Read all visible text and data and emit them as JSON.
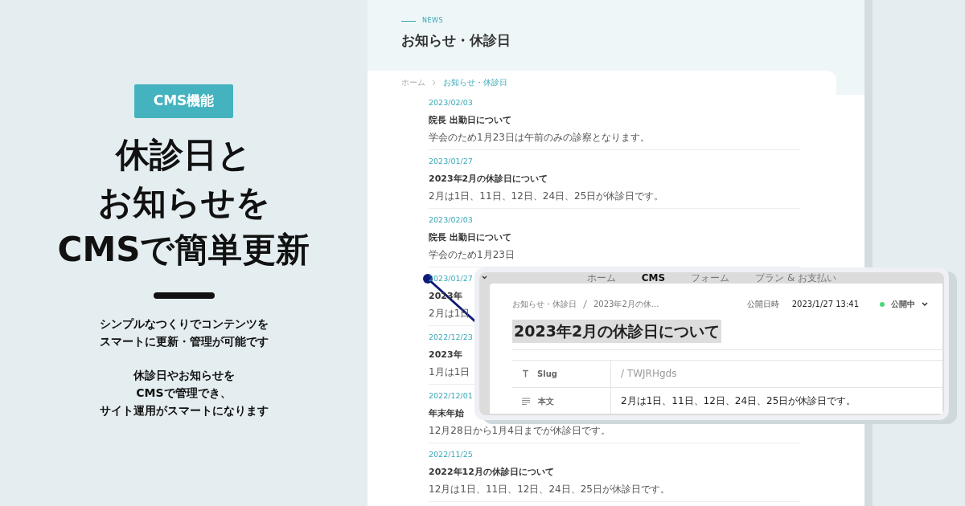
{
  "promo": {
    "badge": "CMS機能",
    "headline": [
      "休診日と",
      "お知らせを",
      "CMSで簡単更新"
    ],
    "paragraphs": [
      [
        "シンプルなつくりでコンテンツを",
        "スマートに更新・管理が可能です"
      ],
      [
        "休診日やお知らせを",
        "CMSで管理でき、",
        "サイト運用がスマートになります"
      ]
    ]
  },
  "site": {
    "eyebrow": "NEWS",
    "title": "お知らせ・休診日",
    "breadcrumb": [
      {
        "label": "ホーム",
        "selected": false
      },
      {
        "label": "お知らせ・休診日",
        "selected": true
      }
    ],
    "news": [
      {
        "date": "2023/02/03",
        "title": "院長 出勤日について",
        "body": "学会のため1月23日は午前のみの診察となります。"
      },
      {
        "date": "2023/01/27",
        "title": "2023年2月の休診日について",
        "body": "2月は1日、11日、12日、24日、25日が休診日です。"
      },
      {
        "date": "2023/02/03",
        "title": "院長 出勤日について",
        "body": "学会のため1月23日"
      },
      {
        "date": "2023/01/27",
        "title": "2023年",
        "body": "2月は1日"
      },
      {
        "date": "2022/12/23",
        "title": "2023年",
        "body": "1月は1日"
      },
      {
        "date": "2022/12/01",
        "title": "年末年始",
        "body": "12月28日から1月4日までが休診日です。"
      },
      {
        "date": "2022/11/25",
        "title": "2022年12月の休診日について",
        "body": "12月は1日、11日、12日、24日、25日が休診日です。"
      }
    ]
  },
  "cms_window": {
    "tabs": [
      {
        "label": "ホーム",
        "selected": false
      },
      {
        "label": "CMS",
        "selected": true
      },
      {
        "label": "フォーム",
        "selected": false
      },
      {
        "label": "プラン & お支払い",
        "selected": false
      }
    ],
    "breadcrumb": [
      "お知らせ・休診日",
      "2023年2月の休..."
    ],
    "published_label": "公開日時",
    "published_at": "2023/1/27 13:41",
    "status": {
      "label": "公開中",
      "published": true
    },
    "title": "2023年2月の休診日について",
    "fields": [
      {
        "kind": "text",
        "label": "Slug",
        "value": "/ TWJRHgds"
      },
      {
        "kind": "richtext",
        "label": "本文",
        "value": "2月は1日、11日、12日、24日、25日が休診日です。"
      }
    ]
  }
}
